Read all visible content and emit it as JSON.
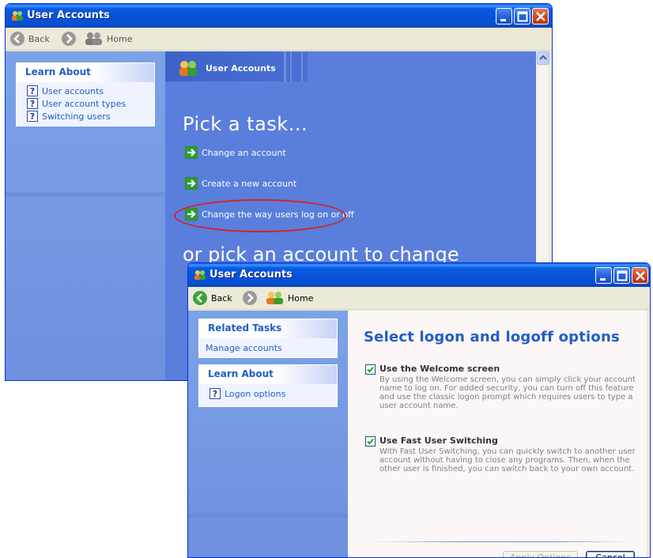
{
  "back_window": {
    "title": "User Accounts",
    "toolbar": {
      "back_label": "Back",
      "home_label": "Home"
    },
    "learn_about": {
      "heading": "Learn About",
      "items": [
        "User accounts",
        "User account types",
        "Switching users"
      ]
    },
    "header_title": "User Accounts",
    "pick_task_title": "Pick a task...",
    "tasks": [
      "Change an account",
      "Create a new account",
      "Change the way users log on or off"
    ],
    "highlighted_task_index": 2,
    "or_pick_title": "or pick an account to change"
  },
  "front_window": {
    "title": "User Accounts",
    "toolbar": {
      "back_label": "Back",
      "home_label": "Home"
    },
    "related_tasks": {
      "heading": "Related Tasks",
      "items": [
        "Manage accounts"
      ]
    },
    "learn_about": {
      "heading": "Learn About",
      "items": [
        "Logon options"
      ]
    },
    "page_title": "Select logon and logoff options",
    "options": [
      {
        "label": "Use the Welcome screen",
        "checked": true,
        "description": "By using the Welcome screen, you can simply click your account name to log on. For added security, you can turn off this feature and use the classic logon prompt which requires users to type a user account name."
      },
      {
        "label": "Use Fast User Switching",
        "checked": true,
        "description": "With Fast User Switching, you can quickly switch to another user account without having to close any programs. Then, when the other user is finished, you can switch back to your own account."
      }
    ],
    "buttons": {
      "apply_label": "Apply Options",
      "cancel_label": "Cancel"
    }
  },
  "colors": {
    "title_bar": "#0553d8",
    "task_pane_blue": "#5a7edc",
    "link_blue": "#215dc6",
    "highlight_oval": "#d12229"
  },
  "icons": [
    "user-accounts-icon",
    "back-arrow-icon",
    "forward-arrow-icon",
    "home-users-icon",
    "help-icon",
    "green-arrow-icon",
    "checkbox-checked-icon",
    "minimize-icon",
    "maximize-icon",
    "close-icon"
  ]
}
